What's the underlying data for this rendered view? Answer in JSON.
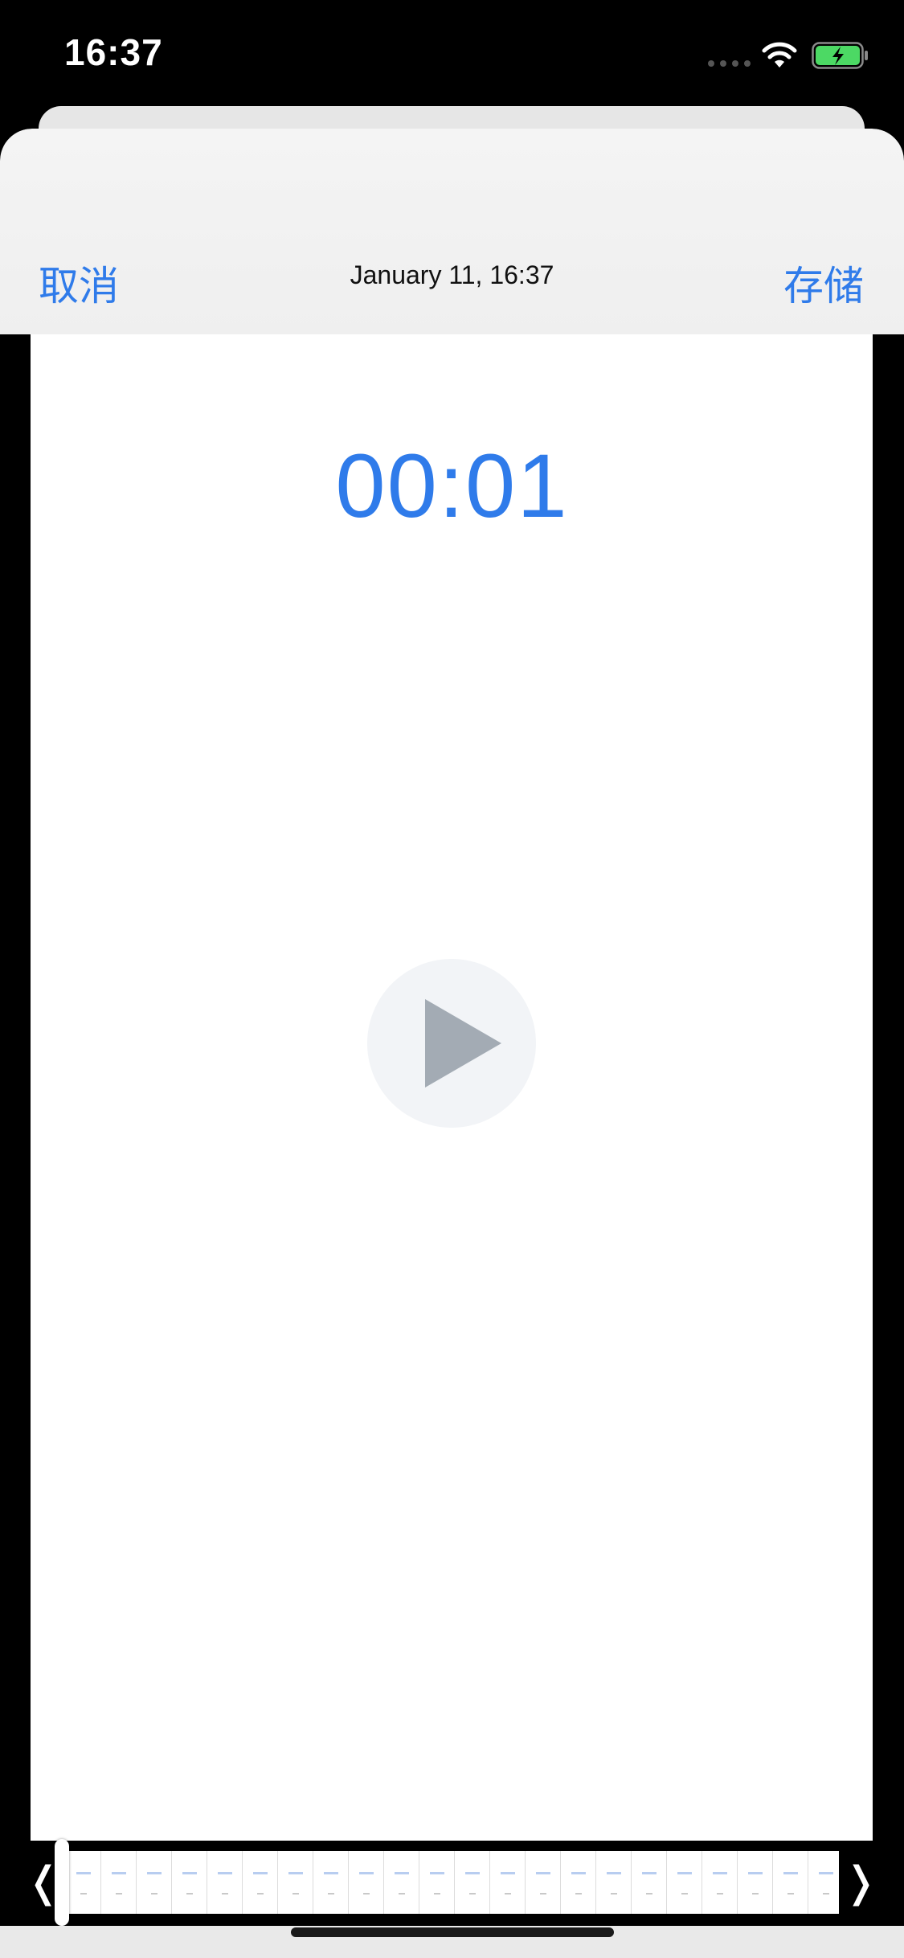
{
  "status_bar": {
    "time": "16:37",
    "icons": [
      "signal-icon",
      "wifi-icon",
      "battery-charging-icon"
    ]
  },
  "nav": {
    "cancel_label": "取消",
    "title": "January 11, 16:37",
    "save_label": "存储"
  },
  "player": {
    "timer": "00:01",
    "play_icon": "play-icon"
  },
  "scrubber": {
    "left_handle_icon": "chevron-left-icon",
    "right_handle_icon": "chevron-right-icon",
    "left_handle_glyph": "❬",
    "right_handle_glyph": "❭",
    "frame_count": 22
  },
  "colors": {
    "accent": "#2f7bea",
    "nav_bg": "#f2f2f2",
    "play_button_bg": "#f2f4f7",
    "play_icon": "#a3abb4"
  }
}
